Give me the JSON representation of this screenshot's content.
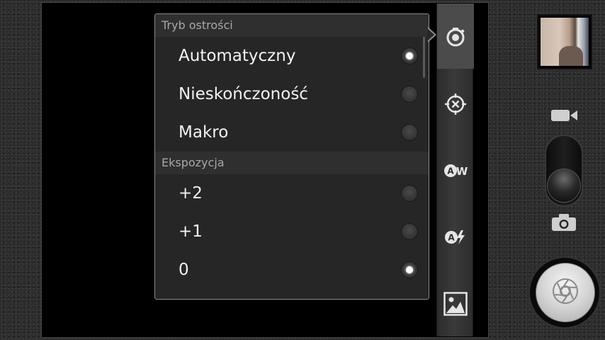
{
  "focus_section": {
    "header": "Tryb ostrości",
    "options": [
      {
        "label": "Automatyczny",
        "checked": true
      },
      {
        "label": "Nieskończoność",
        "checked": false
      },
      {
        "label": "Makro",
        "checked": false
      }
    ]
  },
  "exposure_section": {
    "header": "Ekspozycja",
    "options": [
      {
        "label": "+2",
        "checked": false
      },
      {
        "label": "+1",
        "checked": false
      },
      {
        "label": "0",
        "checked": true
      }
    ]
  },
  "settings_strip": {
    "icons": [
      "camera-settings-icon",
      "focus-target-icon",
      "white-balance-auto-icon",
      "flash-auto-icon",
      "gallery-image-icon"
    ],
    "active": "camera-settings-icon",
    "white_balance_glyph": "W",
    "flash_glyph": "A"
  },
  "mode_switch": {
    "icons": [
      "video-camera-icon",
      "photo-camera-icon"
    ],
    "selected": "photo-camera-icon"
  },
  "colors": {
    "popup_bg": "#262626",
    "section_header_bg": "#2f2f2f",
    "header_text": "#a8a8a8",
    "option_text": "#f2f2f2"
  }
}
